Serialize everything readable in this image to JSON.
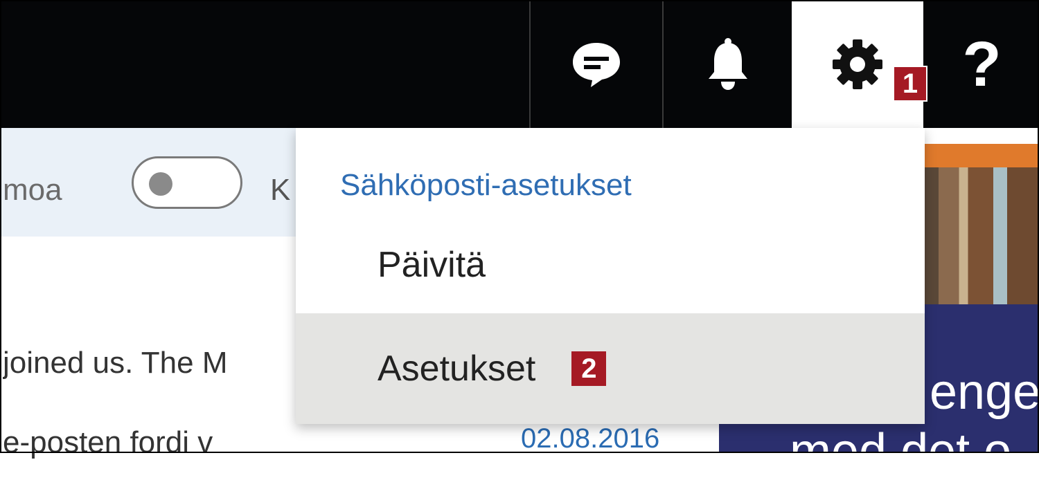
{
  "topbar": {
    "icons": [
      "chat-bubble-icon",
      "bell-icon",
      "gear-icon",
      "question-icon"
    ],
    "help_glyph": "?",
    "settings_callout": "1"
  },
  "toolbar": {
    "left_text": "moa",
    "after_toggle_text": "K"
  },
  "menu": {
    "header": "Sähköposti-asetukset",
    "items": [
      {
        "label": "Päivitä"
      },
      {
        "label": "Asetukset",
        "callout": "2"
      }
    ]
  },
  "messages": [
    {
      "preview": "joined us. The M"
    },
    {
      "preview": "e-posten fordi v",
      "date": "02.08.2016"
    }
  ],
  "ad": {
    "text_lines": [
      "enger",
      "med det o"
    ]
  },
  "colors": {
    "topbar_bg": "#050608",
    "accent_blue": "#2f6db3",
    "callout_red": "#a51a24",
    "menu_highlight": "#e4e4e2"
  }
}
